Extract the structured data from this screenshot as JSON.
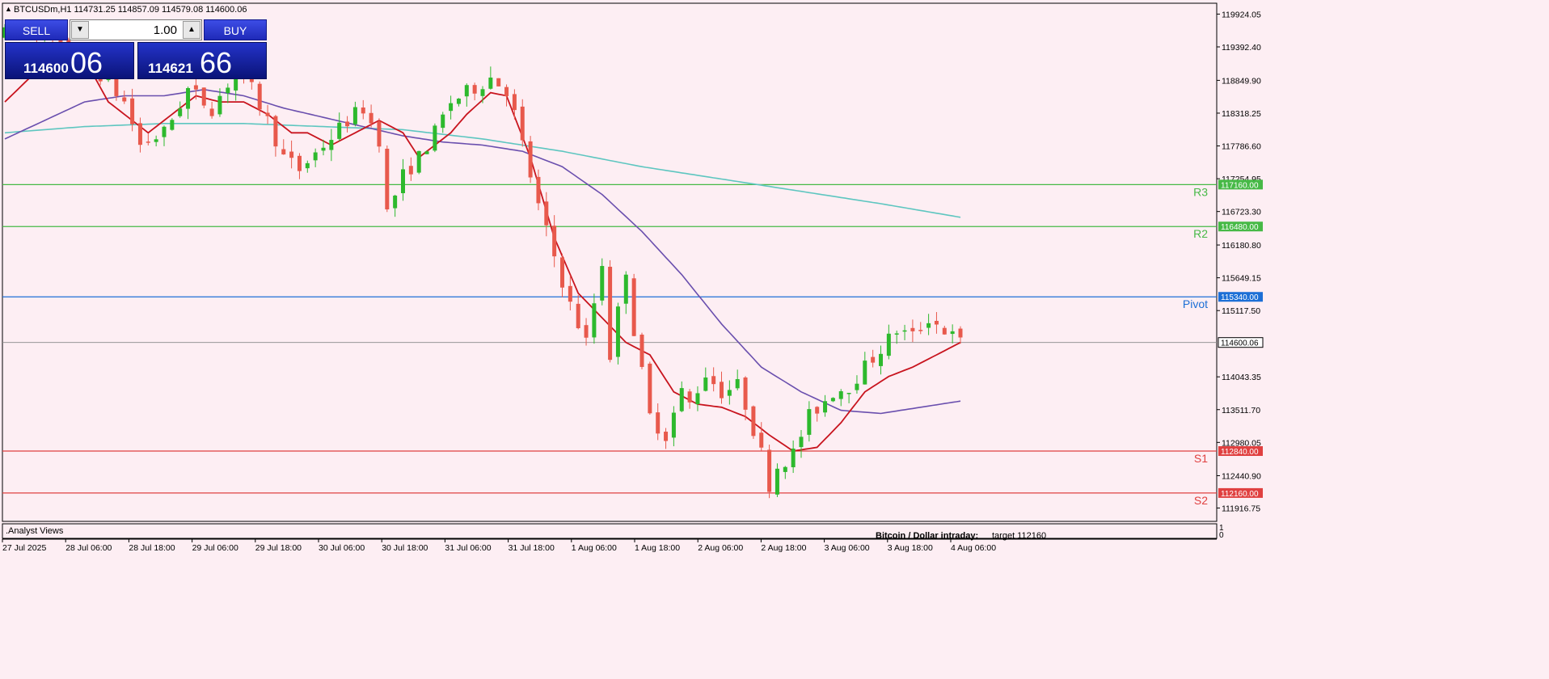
{
  "header": {
    "triangle": "▲",
    "symbol_line": "BTCUSDm,H1  114731.25 114857.09 114579.08 114600.06"
  },
  "trade_panel": {
    "sell_label": "SELL",
    "buy_label": "BUY",
    "lot": "1.00",
    "sell_price_small": "114600",
    "sell_price_big": "06",
    "buy_price_small": "114621",
    "buy_price_big": "66"
  },
  "footer": {
    "indicator_label": ".Analyst Views",
    "annotation_title": "Bitcoin / Dollar intraday:",
    "annotation_text": "target 112160",
    "sub_axis_top": "1",
    "sub_axis_bottom": "0"
  },
  "colors": {
    "background": "#fdeef3",
    "bull": "#2db92d",
    "bear": "#e8594c",
    "ma_fast": "#c8141e",
    "ma_mid": "#6a4fae",
    "ma_slow": "#5ec6c0",
    "resistance": "#46b946",
    "pivot": "#1c6fd6",
    "support": "#e04040",
    "current": "#000000"
  },
  "chart_data": {
    "type": "candlestick",
    "symbol": "BTCUSDm",
    "timeframe": "H1",
    "ohlc_header": {
      "open": 114731.25,
      "high": 114857.09,
      "low": 114579.08,
      "close": 114600.06
    },
    "y_ticks": [
      "119924.05",
      "119392.40",
      "118849.90",
      "118318.25",
      "117786.60",
      "117254.95",
      "116723.30",
      "116180.80",
      "115649.15",
      "115117.50",
      "114043.35",
      "113511.70",
      "112980.05",
      "112440.90",
      "111916.75"
    ],
    "x_ticks": [
      "27 Jul 2025",
      "28 Jul 06:00",
      "28 Jul 18:00",
      "29 Jul 06:00",
      "29 Jul 18:00",
      "30 Jul 06:00",
      "30 Jul 18:00",
      "31 Jul 06:00",
      "31 Jul 18:00",
      "1 Aug 06:00",
      "1 Aug 18:00",
      "2 Aug 06:00",
      "2 Aug 18:00",
      "3 Aug 06:00",
      "3 Aug 18:00",
      "4 Aug 06:00"
    ],
    "ylim": [
      111700,
      120100
    ],
    "levels": [
      {
        "name": "R3",
        "value": 117160.0,
        "label": "117160.00"
      },
      {
        "name": "R2",
        "value": 116480.0,
        "label": "116480.00"
      },
      {
        "name": "Pivot",
        "value": 115340.0,
        "label": "115340.00"
      },
      {
        "name": "S1",
        "value": 112840.0,
        "label": "112840.00"
      },
      {
        "name": "S2",
        "value": 112160.0,
        "label": "112160.00"
      }
    ],
    "current_price": {
      "value": 114600.06,
      "label": "114600.06"
    },
    "close_path": [
      [
        0,
        119600
      ],
      [
        3,
        119700
      ],
      [
        6,
        119500
      ],
      [
        9,
        119100
      ],
      [
        12,
        118950
      ],
      [
        15,
        118500
      ],
      [
        17,
        117800
      ],
      [
        20,
        118000
      ],
      [
        23,
        118700
      ],
      [
        26,
        118400
      ],
      [
        29,
        119000
      ],
      [
        31,
        118700
      ],
      [
        33,
        118200
      ],
      [
        35,
        117600
      ],
      [
        37,
        117400
      ],
      [
        40,
        117800
      ],
      [
        43,
        118200
      ],
      [
        45,
        118400
      ],
      [
        47,
        117900
      ],
      [
        48,
        116700
      ],
      [
        50,
        117300
      ],
      [
        52,
        117600
      ],
      [
        54,
        118000
      ],
      [
        56,
        118500
      ],
      [
        58,
        118650
      ],
      [
        61,
        118900
      ],
      [
        63,
        118700
      ],
      [
        64,
        118300
      ],
      [
        65,
        117800
      ],
      [
        67,
        116800
      ],
      [
        69,
        116000
      ],
      [
        71,
        115200
      ],
      [
        73,
        114600
      ],
      [
        75,
        115900
      ],
      [
        76,
        114400
      ],
      [
        78,
        115800
      ],
      [
        79,
        114800
      ],
      [
        81,
        113400
      ],
      [
        83,
        113100
      ],
      [
        85,
        113800
      ],
      [
        86,
        113600
      ],
      [
        88,
        114100
      ],
      [
        90,
        113800
      ],
      [
        92,
        113900
      ],
      [
        93,
        113600
      ],
      [
        95,
        112800
      ],
      [
        96,
        112300
      ],
      [
        97,
        112600
      ],
      [
        99,
        112800
      ],
      [
        101,
        113400
      ],
      [
        104,
        113800
      ],
      [
        106,
        113900
      ],
      [
        108,
        114200
      ],
      [
        110,
        114500
      ],
      [
        112,
        114800
      ],
      [
        114,
        114700
      ],
      [
        116,
        115000
      ],
      [
        118,
        114800
      ],
      [
        120,
        114600
      ]
    ],
    "ma_fast": [
      [
        0,
        118500
      ],
      [
        4,
        119000
      ],
      [
        7,
        119400
      ],
      [
        10,
        119200
      ],
      [
        13,
        118500
      ],
      [
        16,
        118200
      ],
      [
        18,
        118000
      ],
      [
        21,
        118300
      ],
      [
        24,
        118600
      ],
      [
        27,
        118500
      ],
      [
        30,
        118500
      ],
      [
        33,
        118300
      ],
      [
        36,
        118000
      ],
      [
        38,
        118000
      ],
      [
        41,
        117800
      ],
      [
        44,
        118000
      ],
      [
        47,
        118200
      ],
      [
        50,
        118000
      ],
      [
        52,
        117600
      ],
      [
        54,
        117800
      ],
      [
        56,
        118000
      ],
      [
        58,
        118300
      ],
      [
        61,
        118650
      ],
      [
        63,
        118600
      ],
      [
        66,
        117600
      ],
      [
        69,
        116300
      ],
      [
        72,
        115400
      ],
      [
        75,
        115000
      ],
      [
        78,
        114600
      ],
      [
        81,
        114400
      ],
      [
        84,
        113800
      ],
      [
        87,
        113600
      ],
      [
        90,
        113550
      ],
      [
        93,
        113400
      ],
      [
        96,
        113100
      ],
      [
        99,
        112840
      ],
      [
        102,
        112900
      ],
      [
        105,
        113300
      ],
      [
        108,
        113800
      ],
      [
        111,
        114050
      ],
      [
        114,
        114200
      ],
      [
        117,
        114400
      ],
      [
        120,
        114600
      ]
    ],
    "ma_mid": [
      [
        0,
        117900
      ],
      [
        5,
        118200
      ],
      [
        10,
        118500
      ],
      [
        15,
        118600
      ],
      [
        20,
        118600
      ],
      [
        25,
        118700
      ],
      [
        30,
        118600
      ],
      [
        35,
        118400
      ],
      [
        40,
        118250
      ],
      [
        45,
        118100
      ],
      [
        50,
        117950
      ],
      [
        55,
        117850
      ],
      [
        60,
        117800
      ],
      [
        65,
        117700
      ],
      [
        70,
        117450
      ],
      [
        75,
        117000
      ],
      [
        80,
        116400
      ],
      [
        85,
        115700
      ],
      [
        90,
        114900
      ],
      [
        95,
        114200
      ],
      [
        100,
        113800
      ],
      [
        105,
        113500
      ],
      [
        110,
        113450
      ],
      [
        115,
        113550
      ],
      [
        120,
        113650
      ]
    ],
    "ma_slow": [
      [
        0,
        118000
      ],
      [
        10,
        118100
      ],
      [
        20,
        118150
      ],
      [
        30,
        118150
      ],
      [
        40,
        118100
      ],
      [
        50,
        118050
      ],
      [
        60,
        117900
      ],
      [
        70,
        117700
      ],
      [
        80,
        117450
      ],
      [
        90,
        117250
      ],
      [
        100,
        117050
      ],
      [
        110,
        116850
      ],
      [
        120,
        116630
      ]
    ]
  }
}
